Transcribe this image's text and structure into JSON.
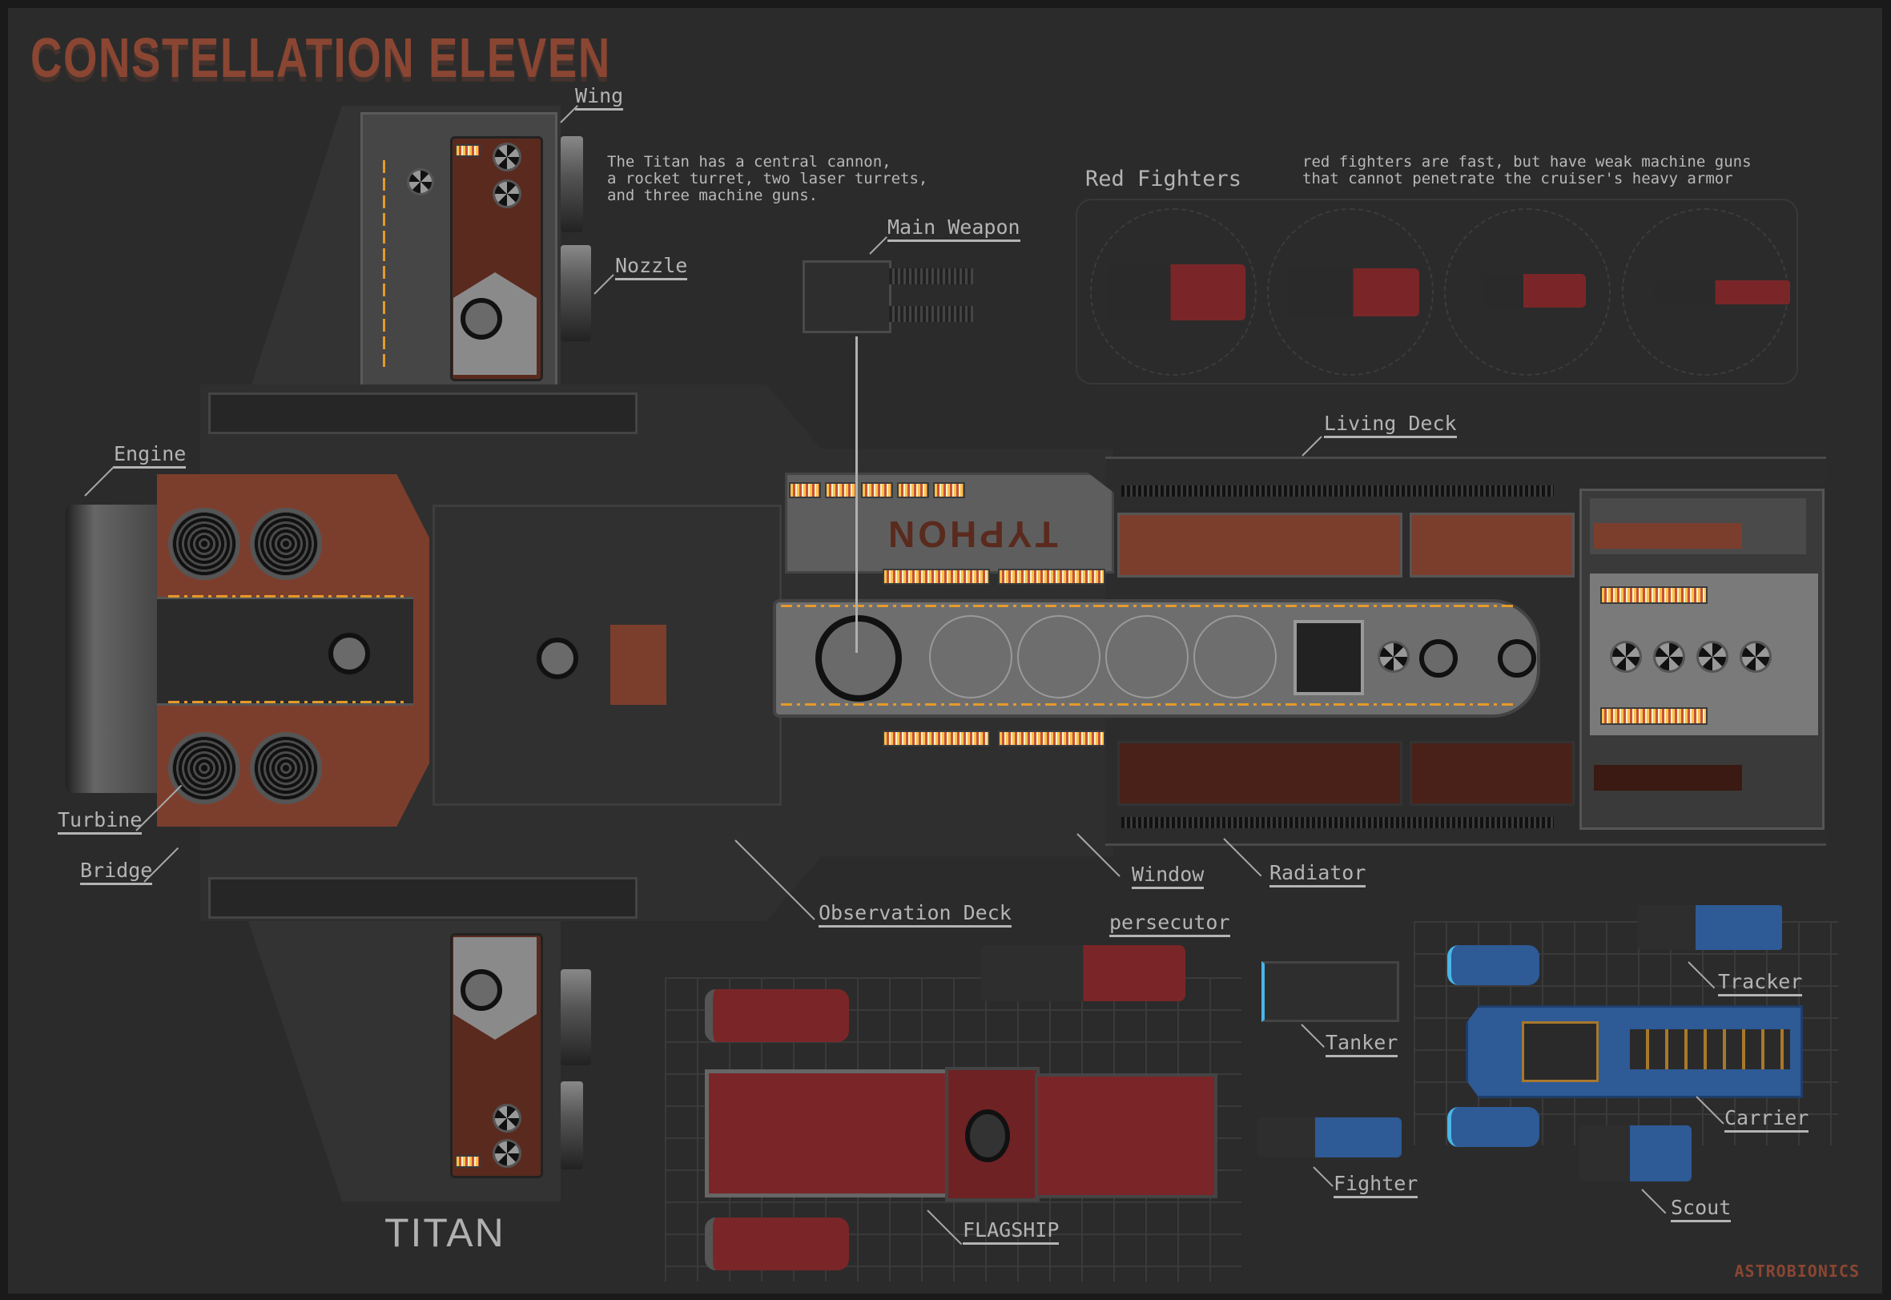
{
  "header": {
    "title": "CONSTELLATION ELEVEN"
  },
  "titan": {
    "name": "TITAN",
    "hull_marking": "TYPHON",
    "note": "The Titan has a central cannon,\na rocket turret, two laser turrets,\nand three machine guns.",
    "labels": {
      "wing": "Wing",
      "nozzle": "Nozzle",
      "main_weapon": "Main Weapon",
      "engine": "Engine",
      "turbine": "Turbine",
      "bridge": "Bridge",
      "living_deck": "Living Deck",
      "window": "Window",
      "radiator": "Radiator",
      "observation_deck": "Observation Deck"
    }
  },
  "red_fighters": {
    "title": "Red Fighters",
    "note": "red fighters are fast, but have weak machine guns\nthat cannot penetrate the cruiser's heavy armor",
    "count": 4
  },
  "fleet": {
    "red": [
      {
        "label": "persecutor"
      },
      {
        "label": "FLAGSHIP"
      }
    ],
    "blue": [
      {
        "label": "Tanker"
      },
      {
        "label": "Fighter"
      },
      {
        "label": "Tracker"
      },
      {
        "label": "Carrier"
      },
      {
        "label": "Scout"
      }
    ]
  },
  "colors": {
    "background": "#2b2b2b",
    "title_rust": "#8a4632",
    "hull_dark": "#2e2e2e",
    "hull_gray": "#6a6a6a",
    "panel_rust": "#7c3e2c",
    "light_amber": "#f7c34a",
    "flagship_red": "#7a2628",
    "fleet_blue": "#2e5a96",
    "label_gray": "#b4b4b4"
  },
  "signature": "ASTROBIONICS"
}
